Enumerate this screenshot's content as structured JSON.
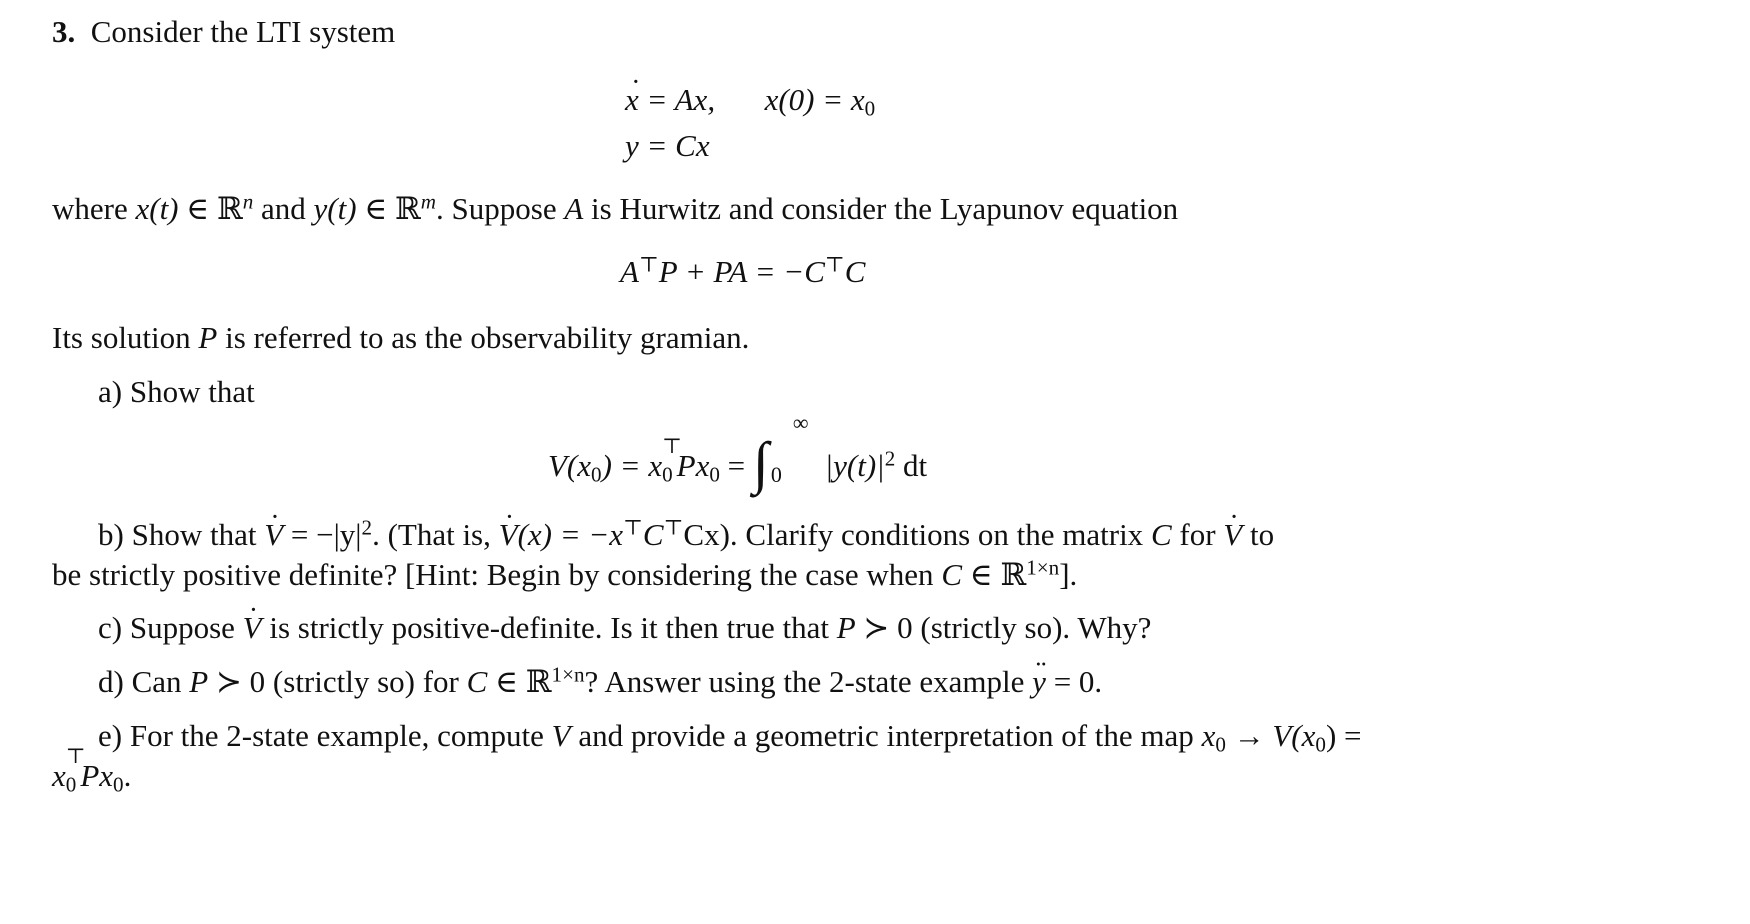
{
  "problem": {
    "number": "3.",
    "intro": "Consider the LTI system",
    "system": {
      "eq1_lhs": "x",
      "eq1_rhs": "= Ax,",
      "eq1_ic": "x(0) = x",
      "eq1_ic_sub": "0",
      "eq2": "y = Cx"
    },
    "where_text": {
      "p1": "where ",
      "xt": "x(t)",
      "in1": " ∈ ℝ",
      "n": "n",
      "and": " and ",
      "yt": "y(t)",
      "in2": " ∈ ℝ",
      "m": "m",
      "p2": ". Suppose ",
      "A": "A",
      "p3": " is Hurwitz and consider the Lyapunov equation"
    },
    "lyapunov": {
      "a1": "A",
      "t1": "⊤",
      "mid": "P + PA = −C",
      "t2": "⊤",
      "end": "C"
    },
    "solution_text": {
      "p1": "Its solution ",
      "P": "P",
      "p2": " is referred to as the observability gramian."
    },
    "parts": {
      "a": {
        "label": "a) Show that",
        "eq_lhs": "V(x",
        "eq_sub0": "0",
        "eq_mid1": ") = x",
        "eq_sub1": "0",
        "eq_T": "⊤",
        "eq_mid2": "Px",
        "eq_sub2": "0",
        "eq_eq": " = ",
        "int_upper": "∞",
        "int_lower": "0",
        "integrand": "|y(t)|",
        "integrand_pow": "2",
        "dt": " dt"
      },
      "b": {
        "line1_p1": "b) Show that ",
        "V1": "V",
        "line1_p2": " = −|y|",
        "pow": "2",
        "line1_p3": ". (That is, ",
        "V2": "V",
        "line1_p4": "(x) = −x",
        "T1": "⊤",
        "line1_p5": "C",
        "T2": "⊤",
        "line1_p6": "Cx). Clarify conditions on the matrix ",
        "C": "C",
        "line1_p7": " for ",
        "V3": "V",
        "line1_p8": " to",
        "line2_p1": "be strictly positive definite? [Hint: Begin by considering the case when ",
        "line2_C": "C",
        "line2_in": " ∈ ℝ",
        "line2_sup": "1×n",
        "line2_end": "]."
      },
      "c": {
        "p1": "c) Suppose ",
        "V": "V",
        "p2": " is strictly positive-definite. Is it then true that ",
        "P": "P",
        "p3": " ≻ 0 (strictly so). Why?"
      },
      "d": {
        "p1": "d) Can ",
        "P": "P",
        "p2": " ≻ 0 (strictly so) for ",
        "C": "C",
        "p3": " ∈ ℝ",
        "sup": "1×n",
        "p4": "? Answer using the 2-state example ",
        "y": "y",
        "p5": " = 0."
      },
      "e": {
        "p1": "e) For the 2-state example, compute ",
        "V": "V",
        "p2": " and provide a geometric interpretation of the map ",
        "x0": "x",
        "x0sub": "0",
        "arrow": " → ",
        "Vx0": "V(x",
        "Vx0sub": "0",
        "p3": ") =",
        "line2_x": "x",
        "line2_sub": "0",
        "line2_T": "⊤",
        "line2_P": "Px",
        "line2_sub2": "0",
        "line2_end": "."
      }
    }
  }
}
